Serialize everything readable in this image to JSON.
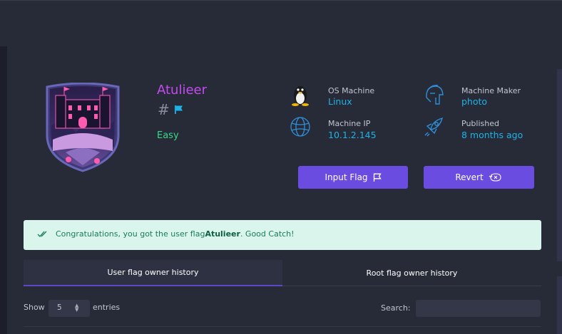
{
  "machine": {
    "name": "Atulieer",
    "hash_symbol": "#",
    "difficulty": "Easy"
  },
  "meta": {
    "os_label": "OS Machine",
    "os_value": "Linux",
    "ip_label": "Machine IP",
    "ip_value": "10.1.2.145",
    "maker_label": "Machine Maker",
    "maker_value": "photo",
    "published_label": "Published",
    "published_value": "8 months ago"
  },
  "actions": {
    "input_flag_label": "Input Flag",
    "revert_label": "Revert"
  },
  "alert": {
    "prefix": "Congratulations, you got the user flag",
    "bold": "Atulieer",
    "suffix": ". Good Catch!"
  },
  "tabs": {
    "user_history": "User flag owner history",
    "root_history": "Root flag owner history"
  },
  "table_controls": {
    "show_label": "Show",
    "page_size": "5",
    "entries_label": "entries",
    "search_label": "Search:",
    "search_value": ""
  },
  "colors": {
    "accent": "#6a4de0",
    "name": "#c34cf0",
    "difficulty": "#39d98a",
    "value": "#1eb3e6",
    "icon": "#2f8fd8",
    "alert_bg": "#d9f5ec"
  },
  "icons": {
    "os": "linux-penguin-icon",
    "ip": "globe-icon",
    "maker": "spartan-helmet-icon",
    "published": "rocket-icon",
    "flag": "flag-icon",
    "revert": "revert-icon",
    "alert": "double-check-icon"
  }
}
